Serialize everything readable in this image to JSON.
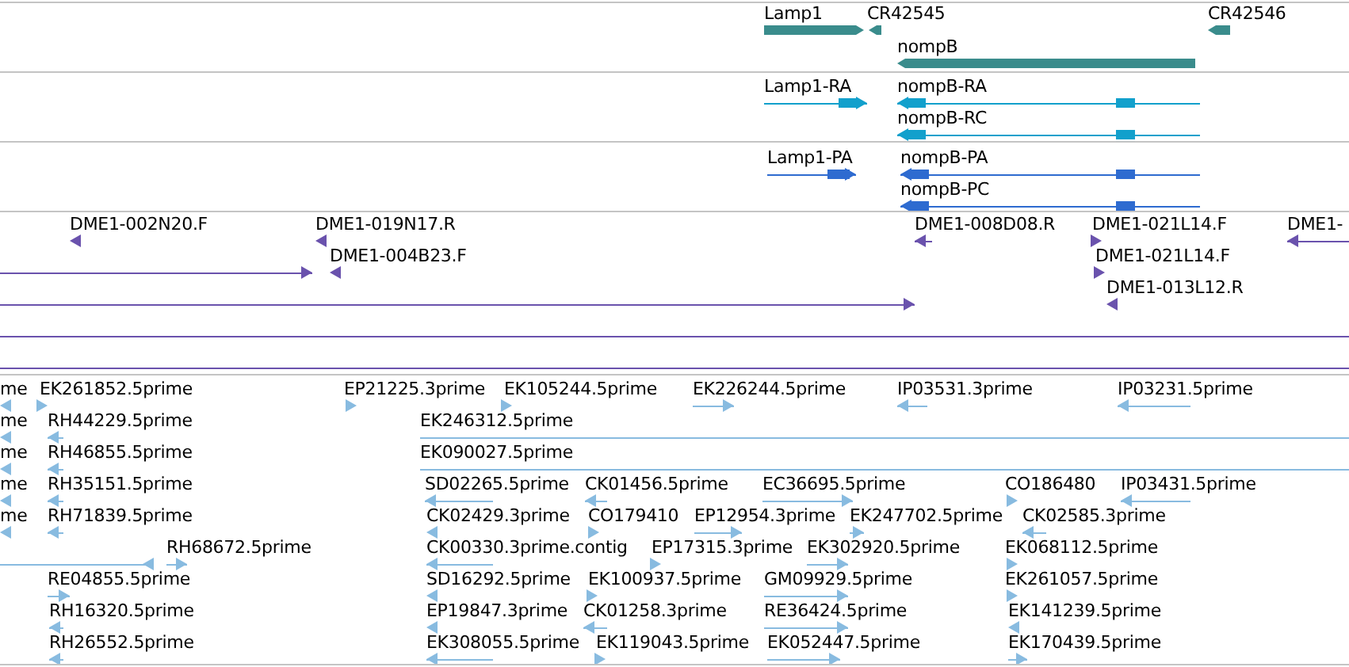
{
  "tracks": [
    {
      "kind": "gene",
      "color": "#3a8c8c",
      "features": [
        {
          "label": "Lamp1",
          "reverse": false
        },
        {
          "label": "CR42545",
          "reverse": true
        },
        {
          "label": "CR42546",
          "reverse": true
        },
        {
          "label": "nompB",
          "reverse": true
        }
      ]
    },
    {
      "kind": "transcript",
      "color": "#12a0cc",
      "features": [
        {
          "label": "Lamp1-RA",
          "reverse": false
        },
        {
          "label": "nompB-RA",
          "reverse": true
        },
        {
          "label": "nompB-RC",
          "reverse": true
        }
      ]
    },
    {
      "kind": "transcript",
      "color": "#2e6bd0",
      "features": [
        {
          "label": "Lamp1-PA",
          "reverse": false
        },
        {
          "label": "nompB-PA",
          "reverse": true
        },
        {
          "label": "nompB-PC",
          "reverse": true
        }
      ]
    },
    {
      "kind": "alignment",
      "color": "#6a52ad",
      "features": [
        {
          "label": "DME1-002N20.F",
          "reverse": true
        },
        {
          "label": "DME1-019N17.R",
          "reverse": true
        },
        {
          "label": "DME1-008D08.R",
          "reverse": true
        },
        {
          "label": "DME1-021L14.F",
          "reverse": false
        },
        {
          "label": "DME1-",
          "reverse": true
        },
        {
          "reverse": false
        },
        {
          "label": "DME1-004B23.F",
          "reverse": true
        },
        {
          "label": "DME1-021L14.F",
          "reverse": false
        },
        {
          "reverse": false
        },
        {
          "label": "DME1-013L12.R",
          "reverse": true
        },
        {
          "reverse": false
        },
        {
          "reverse": false
        }
      ]
    },
    {
      "kind": "alignment",
      "color": "#88bbe0",
      "features": [
        {
          "label": "me",
          "reverse": true
        },
        {
          "label": "EK261852.5prime",
          "reverse": false
        },
        {
          "label": "EP21225.3prime",
          "reverse": false
        },
        {
          "label": "EK105244.5prime",
          "reverse": false
        },
        {
          "label": "EK226244.5prime",
          "reverse": false
        },
        {
          "label": "IP03531.3prime",
          "reverse": true
        },
        {
          "label": "IP03231.5prime",
          "reverse": true
        },
        {
          "label": "me",
          "reverse": true
        },
        {
          "label": "RH44229.5prime",
          "reverse": true
        },
        {
          "label": "EK246312.5prime",
          "reverse": false
        },
        {
          "label": "me",
          "reverse": true
        },
        {
          "label": "RH46855.5prime",
          "reverse": true
        },
        {
          "label": "EK090027.5prime",
          "reverse": false
        },
        {
          "label": "me",
          "reverse": true
        },
        {
          "label": "RH35151.5prime",
          "reverse": true
        },
        {
          "label": "SD02265.5prime",
          "reverse": true
        },
        {
          "label": "CK01456.5prime",
          "reverse": true
        },
        {
          "label": "EC36695.5prime",
          "reverse": false
        },
        {
          "label": "CO186480",
          "reverse": false
        },
        {
          "label": "IP03431.5prime",
          "reverse": true
        },
        {
          "label": "me",
          "reverse": true
        },
        {
          "label": "RH71839.5prime",
          "reverse": true
        },
        {
          "label": "CK02429.3prime",
          "reverse": true
        },
        {
          "label": "CO179410",
          "reverse": false
        },
        {
          "label": "EP12954.3prime",
          "reverse": false
        },
        {
          "label": "EK247702.5prime",
          "reverse": false
        },
        {
          "label": "CK02585.3prime",
          "reverse": true
        },
        {
          "reverse": true
        },
        {
          "label": "RH68672.5prime",
          "reverse": false
        },
        {
          "label": "CK00330.3prime.contig",
          "reverse": true
        },
        {
          "label": "EP17315.3prime",
          "reverse": false
        },
        {
          "label": "EK302920.5prime",
          "reverse": false
        },
        {
          "label": "EK068112.5prime",
          "reverse": false
        },
        {
          "label": "RE04855.5prime",
          "reverse": false
        },
        {
          "label": "SD16292.5prime",
          "reverse": true
        },
        {
          "label": "EK100937.5prime",
          "reverse": false
        },
        {
          "label": "GM09929.5prime",
          "reverse": false
        },
        {
          "label": "EK261057.5prime",
          "reverse": false
        },
        {
          "label": "RH16320.5prime",
          "reverse": true
        },
        {
          "label": "EP19847.3prime",
          "reverse": true
        },
        {
          "label": "CK01258.3prime",
          "reverse": true
        },
        {
          "label": "RE36424.5prime",
          "reverse": false
        },
        {
          "label": "EK141239.5prime",
          "reverse": true
        },
        {
          "label": "RH26552.5prime",
          "reverse": true
        },
        {
          "label": "EK308055.5prime",
          "reverse": true
        },
        {
          "label": "EK119043.5prime",
          "reverse": false
        },
        {
          "label": "EK052447.5prime",
          "reverse": false
        },
        {
          "label": "EK170439.5prime",
          "reverse": false
        }
      ]
    }
  ]
}
